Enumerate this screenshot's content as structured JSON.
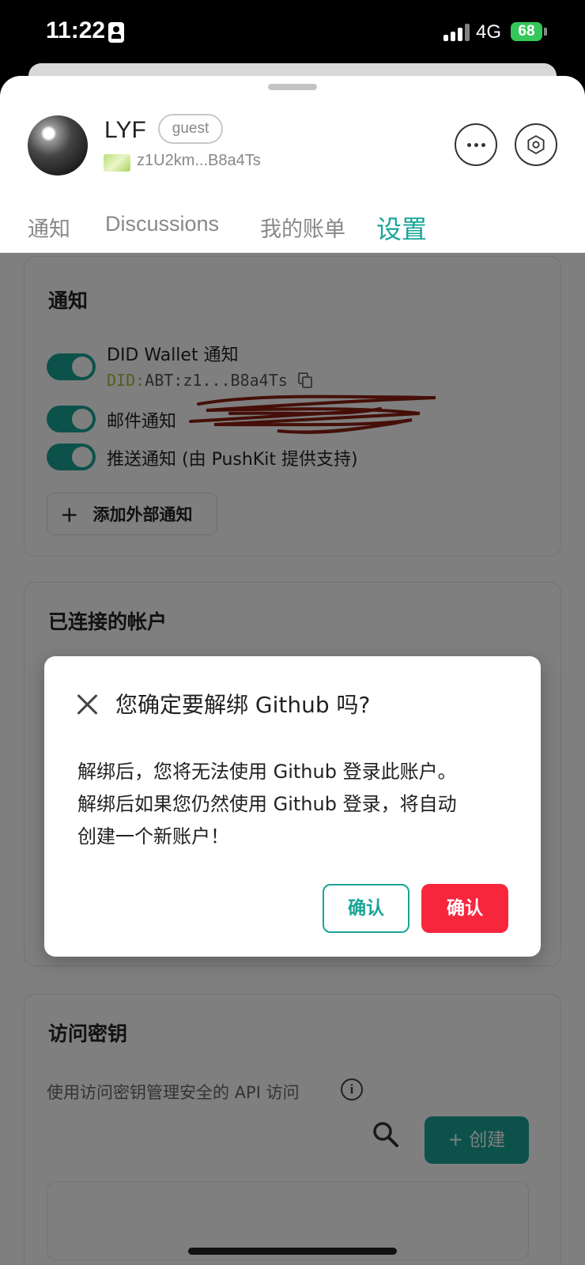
{
  "status_bar": {
    "time": "11:22",
    "network": "4G",
    "battery": "68"
  },
  "profile": {
    "name": "LYF",
    "role": "guest",
    "did_short": "z1U2km...B8a4Ts"
  },
  "tabs": [
    {
      "label": "通知",
      "active": false
    },
    {
      "label": "Discussions",
      "active": false
    },
    {
      "label": "我的账单",
      "active": false
    },
    {
      "label": "设置",
      "active": true
    }
  ],
  "notifications": {
    "title": "通知",
    "did_wallet_label": "DID Wallet 通知",
    "did_prefix": "DID:",
    "did_value": "ABT:z1...B8a4Ts",
    "email_label": "邮件通知",
    "push_label": "推送通知 (由 PushKit 提供支持)",
    "add_button": "添加外部通知"
  },
  "connected_accounts": {
    "title": "已连接的帐户"
  },
  "access_keys": {
    "title": "访问密钥",
    "subtitle": "使用访问密钥管理安全的 API 访问",
    "create_button": "+ 创建"
  },
  "dialog": {
    "title": "您确定要解绑 Github 吗?",
    "body_lines": [
      "解绑后，您将无法使用 Github 登录此账户。",
      "解绑后如果您仍然使用 Github 登录，将自动",
      "创建一个新账户！"
    ],
    "cancel_button": "确认",
    "confirm_button": "确认"
  },
  "colors": {
    "accent": "#18a597",
    "danger": "#f7263d",
    "did_prefix": "#a4c13c"
  }
}
